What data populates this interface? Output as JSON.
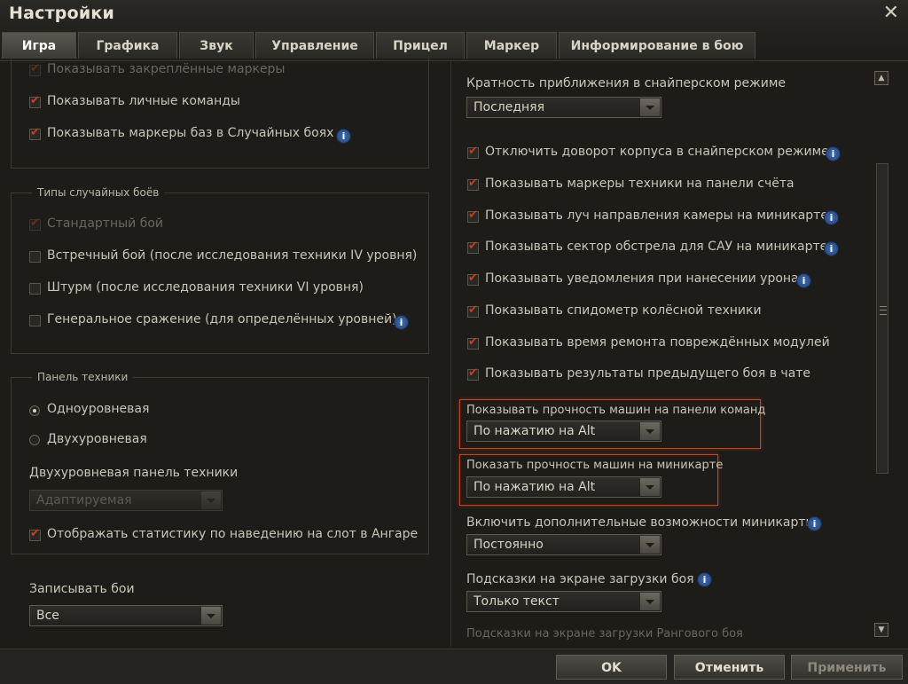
{
  "window": {
    "title": "Настройки",
    "close": "✕"
  },
  "tabs": [
    "Игра",
    "Графика",
    "Звук",
    "Управление",
    "Прицел",
    "Маркер",
    "Информирование в бою"
  ],
  "left": {
    "top_checks": [
      {
        "label": "Показывать закреплённые маркеры",
        "checked": true,
        "disabled": true
      },
      {
        "label": "Показывать личные команды",
        "checked": true
      },
      {
        "label": "Показывать маркеры баз в Случайных боях",
        "checked": true,
        "info": "i"
      }
    ],
    "battle_types": {
      "title": "Типы случайных боёв",
      "items": [
        {
          "label": "Стандартный бой",
          "checked": true,
          "disabled": true
        },
        {
          "label": "Встречный бой (после исследования техники IV уровня)",
          "checked": false
        },
        {
          "label": "Штурм (после исследования техники VI уровня)",
          "checked": false
        },
        {
          "label": "Генеральное сражение (для определённых уровней)",
          "checked": false,
          "info": "i"
        }
      ]
    },
    "vehicle_panel": {
      "title": "Панель техники",
      "radios": [
        {
          "label": "Одноуровневая",
          "selected": true
        },
        {
          "label": "Двухуровневая",
          "selected": false
        }
      ],
      "two_level_label": "Двухуровневая панель техники",
      "two_level_select": "Адаптируемая",
      "stats_check": {
        "label": "Отображать статистику по наведению на слот в Ангаре",
        "checked": true
      }
    },
    "record": {
      "label": "Записывать бои",
      "value": "Все"
    }
  },
  "right": {
    "zoom": {
      "label": "Кратность приближения в снайперском режиме",
      "value": "Последняя"
    },
    "checks": [
      {
        "label": "Отключить доворот корпуса в снайперском режиме",
        "checked": true,
        "info": "i"
      },
      {
        "label": "Показывать маркеры техники на панели счёта",
        "checked": true
      },
      {
        "label": "Показывать луч направления камеры на миникарте",
        "checked": true,
        "info": "i"
      },
      {
        "label": "Показывать сектор обстрела для САУ на миникарте",
        "checked": true,
        "info": "i"
      },
      {
        "label": "Показывать уведомления при нанесении урона",
        "checked": true,
        "info": "i"
      },
      {
        "label": "Показывать спидометр колёсной техники",
        "checked": true
      },
      {
        "label": "Показывать время ремонта повреждённых модулей",
        "checked": true
      },
      {
        "label": "Показывать результаты предыдущего боя в чате",
        "checked": true
      }
    ],
    "hp_team": {
      "label": "Показывать прочность машин на панели команд",
      "value": "По нажатию на Alt"
    },
    "hp_minimap": {
      "label": "Показать прочность машин на миникарте",
      "value": "По нажатию на Alt"
    },
    "minimap_extra": {
      "label": "Включить дополнительные возможности миникарты",
      "value": "Постоянно",
      "info": "i"
    },
    "loading_hints": {
      "label": "Подсказки на экране загрузки боя",
      "value": "Только текст",
      "info": "i"
    },
    "ranked_hints": {
      "label": "Подсказки на экране загрузки Рангового боя"
    }
  },
  "buttons": {
    "ok": "OK",
    "cancel": "Отменить",
    "apply": "Применить"
  },
  "colors": {
    "accent": "#c6401c",
    "info": "#3d6fb8",
    "highlight": "#c8441c"
  }
}
